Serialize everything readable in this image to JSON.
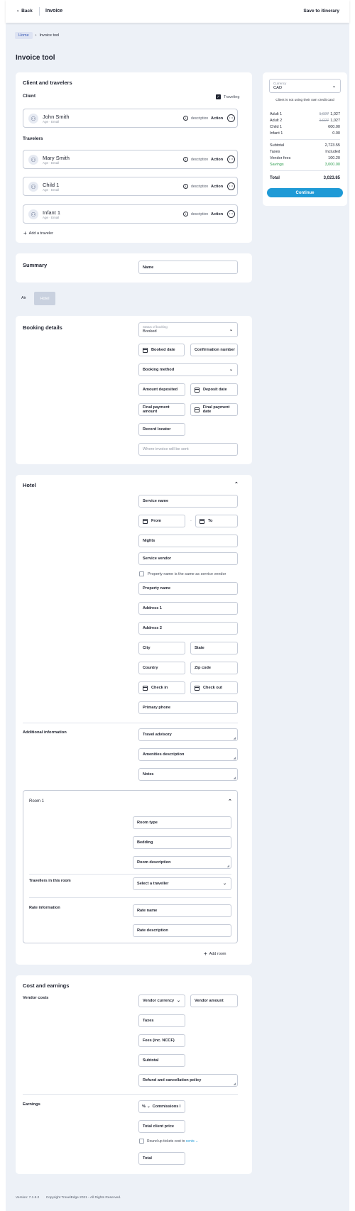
{
  "topbar": {
    "back": "Back",
    "title": "Invoice",
    "save": "Save to itinerary"
  },
  "breadcrumb": {
    "home": "Home",
    "current": "Invoice tool"
  },
  "page_title": "Invoice tool",
  "client_section": {
    "title": "Client and travelers",
    "client_label": "Client",
    "traveling_label": "Traveling",
    "travelers_label": "Travelers",
    "add_traveler": "Add a traveler",
    "client": {
      "name": "John Smith",
      "meta": "Age · Email"
    },
    "travelers": [
      {
        "name": "Mary Smith",
        "meta": "Age · Email"
      },
      {
        "name": "Child 1",
        "meta": "Age · Email"
      },
      {
        "name": "Infant 1",
        "meta": "Age · Email"
      }
    ],
    "desc_label": "description",
    "action_label": "Action"
  },
  "summary": {
    "title": "Summary",
    "name_placeholder": "Name"
  },
  "tabs": {
    "air": "Air",
    "hotel": "Hotel"
  },
  "booking": {
    "title": "Booking details",
    "status_label": "Status of booking",
    "status_value": "Booked",
    "booked_date": "Booked date",
    "confirmation": "Confirmation number",
    "method": "Booking method",
    "amount_deposited": "Amount deposited",
    "deposit_date": "Deposit date",
    "final_amount": "Final payment amount",
    "final_date": "Final payment date",
    "record_locator": "Record locator",
    "where_sent": "Where invoice will be sent"
  },
  "hotel": {
    "title": "Hotel",
    "service_name": "Service name",
    "from": "From",
    "dash": "-",
    "to": "To",
    "nights": "Nights",
    "vendor": "Service vendor",
    "same_as_vendor": "Property name is the same as service vendor",
    "property": "Property name",
    "address1": "Address 1",
    "address2": "Address 2",
    "city": "City",
    "state": "State",
    "country": "Country",
    "zip": "Zip code",
    "check_in": "Check in",
    "check_out": "Check out",
    "phone": "Primary phone",
    "additional_title": "Additional information",
    "advisory": "Travel advisory",
    "amenities": "Amenities description",
    "notes": "Notes",
    "room": {
      "title": "Room 1",
      "type": "Room type",
      "bedding": "Bedding",
      "description": "Room description",
      "travellers_title": "Travellers in this room",
      "select_traveller": "Select a traveller",
      "rate_title": "Rate information",
      "rate_name": "Rate name",
      "rate_description": "Rate description"
    },
    "add_room": "Add room"
  },
  "cost": {
    "title": "Cost and earnings",
    "vendor_title": "Vendor costs",
    "vendor_currency": "Vendor currency",
    "vendor_amount": "Vendor amount",
    "taxes": "Taxes",
    "fees": "Fees (inc. NCCF)",
    "subtotal": "Subtotal",
    "refund": "Refund and cancellation policy",
    "earnings_title": "Earnings",
    "pct": "%",
    "commissions": "Commissions",
    "commissions_value": "0",
    "total_client": "Total client price",
    "round_up_prefix": "Round up tickets cost to",
    "round_up_link": "cents",
    "total": "Total"
  },
  "sidebar": {
    "currency_label": "Currency",
    "currency_value": "CAD",
    "notice": "Client is not using their own credit card",
    "lines": [
      {
        "label": "Adult 1",
        "old": "1,027",
        "value": "1,027"
      },
      {
        "label": "Adult 2",
        "old": "1,027",
        "value": "1,027"
      },
      {
        "label": "Child 1",
        "old": "",
        "value": "600.00"
      },
      {
        "label": "Infant 1",
        "old": "",
        "value": "0.00"
      }
    ],
    "subtotal_label": "Subtotal",
    "subtotal_value": "2,723.55",
    "taxes_label": "Taxes",
    "taxes_value": "Included",
    "vendor_fees_label": "Vendor fees",
    "vendor_fees_value": "100.20",
    "savings_label": "Savings",
    "savings_value": "3,000.00",
    "total_label": "Total",
    "total_value": "3,023.85",
    "continue": "Continue"
  },
  "footer": {
    "version": "Version: 7.1.5.2",
    "copyright": "Copyright TravelEdge 2021 - All Rights Reserved."
  },
  "colors": {
    "accent": "#1f9ad6",
    "savings": "#2e9e4f",
    "background": "#edf1f7"
  }
}
